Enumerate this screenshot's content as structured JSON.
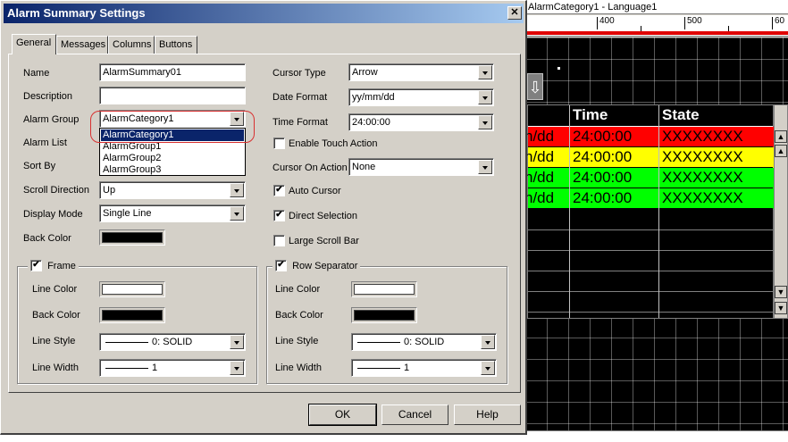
{
  "background": {
    "tab_title": "AlarmCategory1 - Language1",
    "ruler_labels": [
      "400",
      "500",
      "60"
    ],
    "preview": {
      "headers": [
        "Time",
        "State"
      ],
      "first_col_cut": "n/dd",
      "rows": [
        {
          "c1": "n/dd",
          "time": "24:00:00",
          "state": "XXXXXXXX",
          "color": "#ff0000"
        },
        {
          "c1": "n/dd",
          "time": "24:00:00",
          "state": "XXXXXXXX",
          "color": "#ffff00"
        },
        {
          "c1": "n/dd",
          "time": "24:00:00",
          "state": "XXXXXXXX",
          "color": "#00ff00"
        },
        {
          "c1": "n/dd",
          "time": "24:00:00",
          "state": "XXXXXXXX",
          "color": "#00ff00"
        }
      ]
    }
  },
  "dialog": {
    "title": "Alarm Summary Settings",
    "close_glyph": "✕",
    "tabs": [
      "General",
      "Messages",
      "Columns",
      "Buttons"
    ],
    "left": {
      "name_label": "Name",
      "name_value": "AlarmSummary01",
      "description_label": "Description",
      "description_value": "",
      "alarm_group_label": "Alarm Group",
      "alarm_group_value": "AlarmCategory1",
      "alarm_list_label": "Alarm List",
      "sort_by_label": "Sort By",
      "scroll_direction_label": "Scroll Direction",
      "scroll_direction_value": "Up",
      "display_mode_label": "Display Mode",
      "display_mode_value": "Single Line",
      "back_color_label": "Back Color",
      "back_color": "#000000"
    },
    "dropdown_options": [
      "AlarmCategory1",
      "AlarmGroup1",
      "AlarmGroup2",
      "AlarmGroup3"
    ],
    "right": {
      "cursor_type_label": "Cursor Type",
      "cursor_type_value": "Arrow",
      "date_format_label": "Date Format",
      "date_format_value": "yy/mm/dd",
      "time_format_label": "Time Format",
      "time_format_value": "24:00:00",
      "enable_touch_label": "Enable Touch Action",
      "cursor_on_action_label": "Cursor On Action",
      "cursor_on_action_value": "None",
      "auto_cursor_label": "Auto Cursor",
      "direct_selection_label": "Direct Selection",
      "large_scroll_bar_label": "Large Scroll Bar"
    },
    "checks": {
      "enable_touch": false,
      "auto_cursor": true,
      "direct_selection": true,
      "large_scroll_bar": false,
      "frame": true,
      "row_separator": true
    },
    "frame": {
      "title": "Frame",
      "line_color_label": "Line Color",
      "line_color": "#ffffff",
      "back_color_label": "Back Color",
      "back_color": "#000000",
      "line_style_label": "Line Style",
      "line_style_value": "0: SOLID",
      "line_width_label": "Line Width",
      "line_width_value": "1"
    },
    "row_separator": {
      "title": "Row Separator",
      "line_color_label": "Line Color",
      "line_color": "#ffffff",
      "back_color_label": "Back Color",
      "back_color": "#000000",
      "line_style_label": "Line Style",
      "line_style_value": "0: SOLID",
      "line_width_label": "Line Width",
      "line_width_value": "1"
    },
    "buttons": {
      "ok": "OK",
      "cancel": "Cancel",
      "help": "Help"
    }
  }
}
